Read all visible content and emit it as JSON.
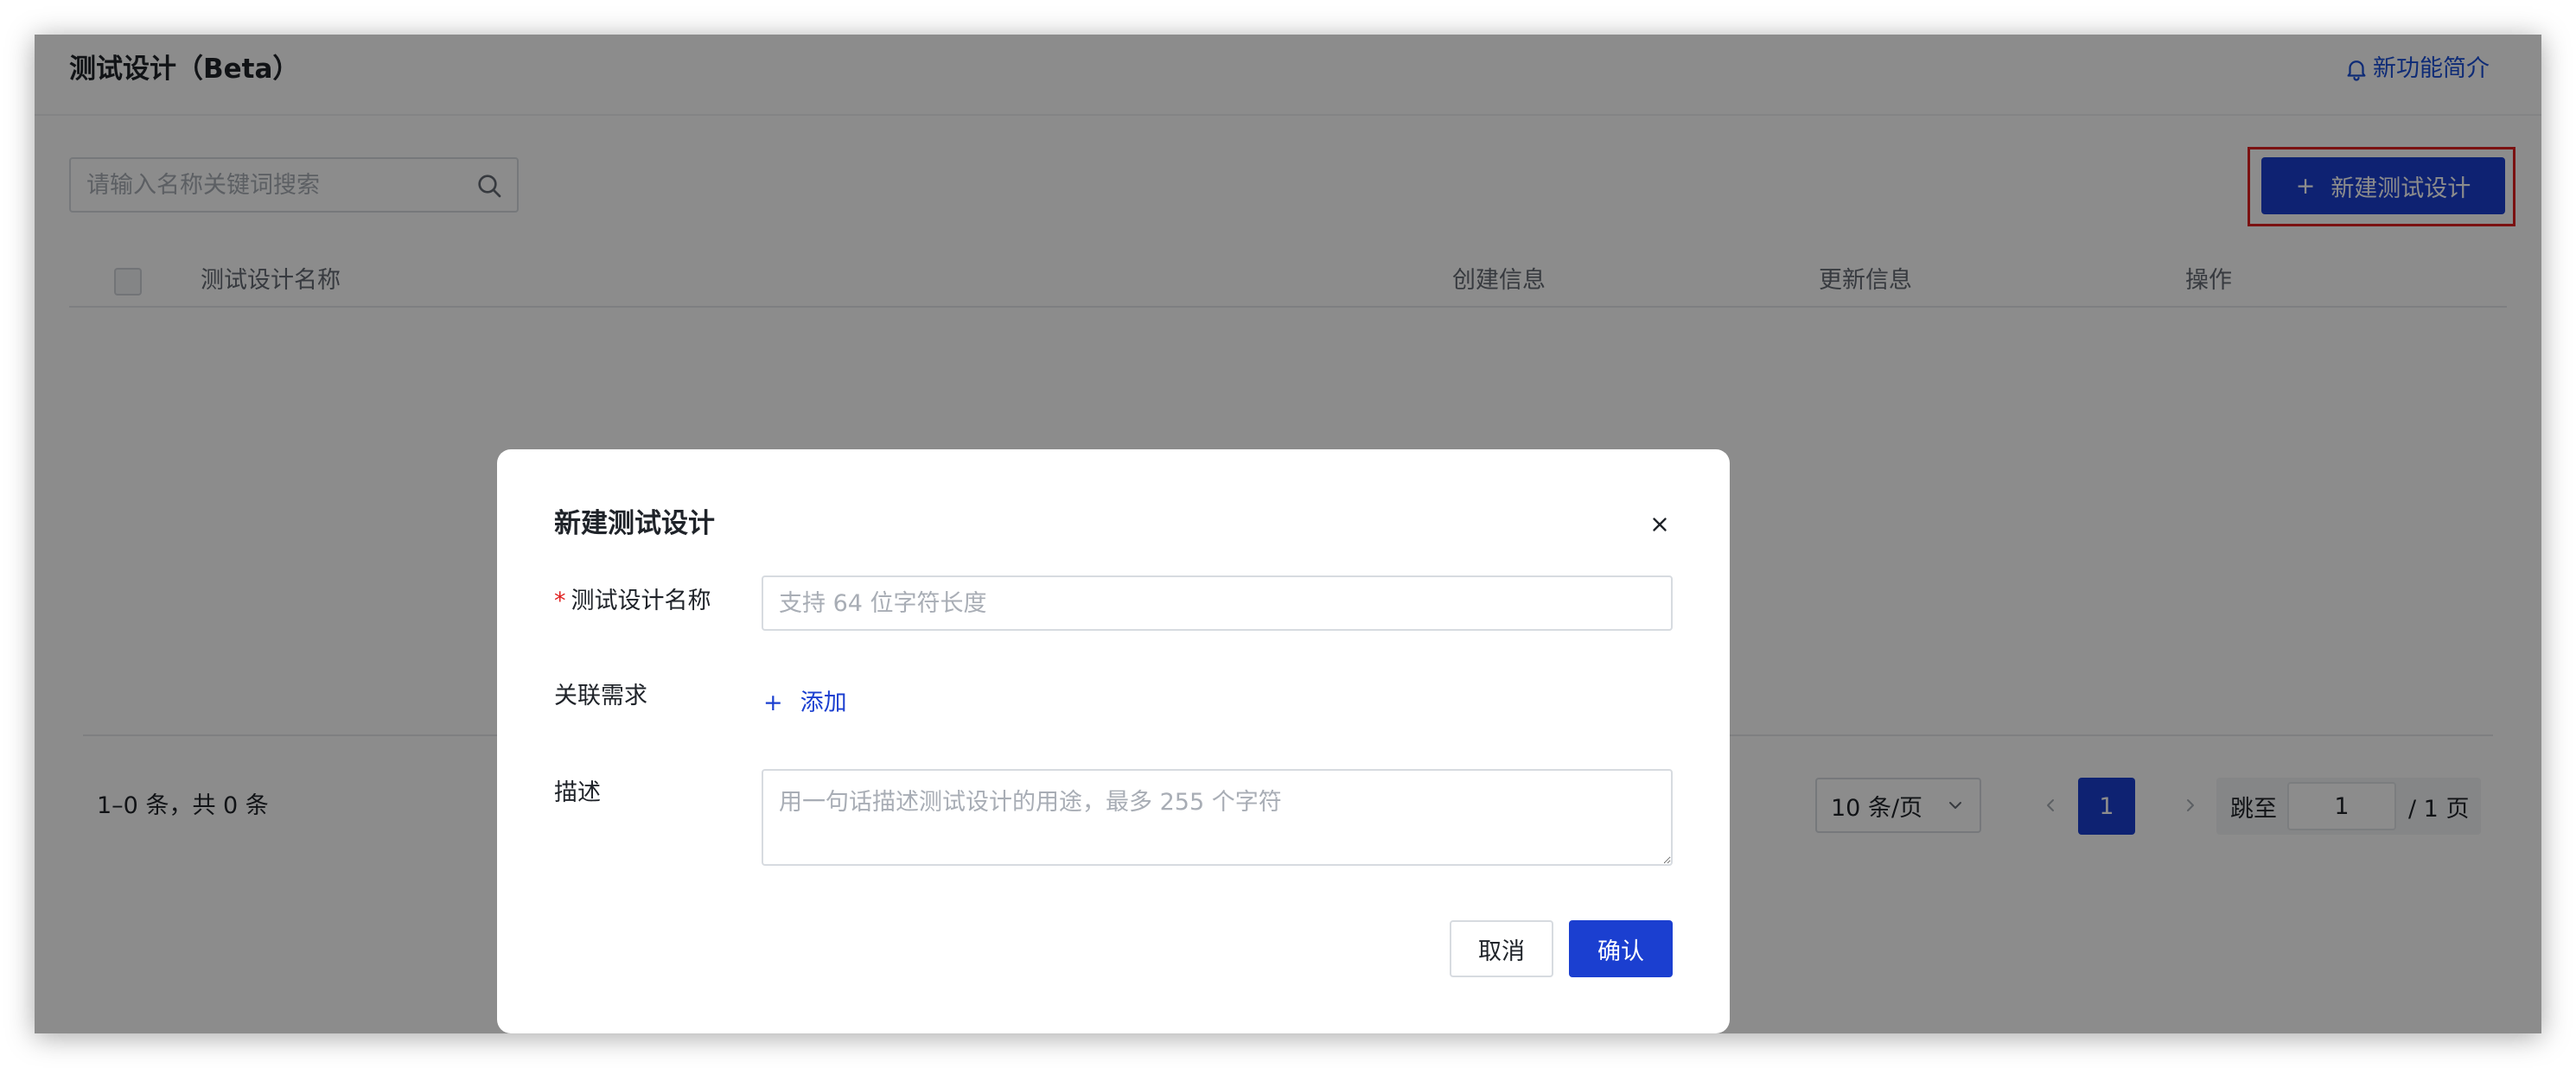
{
  "header": {
    "title": "测试设计（Beta）",
    "whats_new": "新功能简介"
  },
  "toolbar": {
    "search_placeholder": "请输入名称关键词搜索",
    "create_label": "新建测试设计",
    "create_icon_glyph": "+"
  },
  "table": {
    "columns": [
      "测试设计名称",
      "创建信息",
      "更新信息",
      "操作"
    ]
  },
  "pagination": {
    "total_text": "1–0 条，共 0 条",
    "page_size": "10 条/页",
    "current_page": "1",
    "jump_label": "跳至",
    "jump_value": "1",
    "total_pages": "/ 1 页"
  },
  "modal": {
    "title": "新建测试设计",
    "fields": {
      "name": {
        "required_mark": "*",
        "label": "测试设计名称",
        "placeholder": "支持 64 位字符长度"
      },
      "requirements": {
        "label": "关联需求",
        "add_glyph": "+",
        "add_label": "添加"
      },
      "description": {
        "label": "描述",
        "placeholder": "用一句话描述测试设计的用途，最多 255 个字符"
      }
    },
    "cancel_label": "取消",
    "confirm_label": "确认"
  },
  "colors": {
    "primary": "#1b3fd0",
    "link": "#1b4fd8",
    "required": "#e0201f",
    "highlight_border": "#e0201f"
  }
}
